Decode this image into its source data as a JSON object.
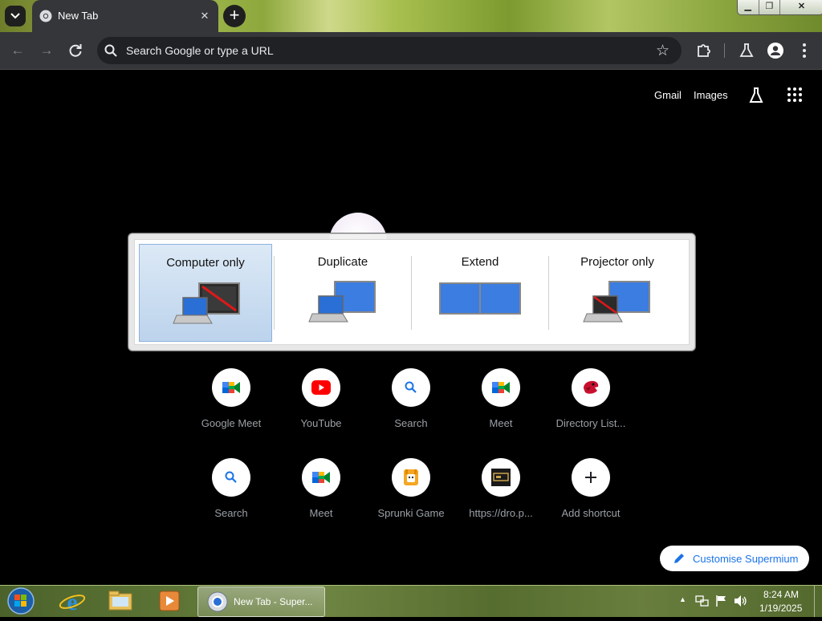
{
  "browser": {
    "tab_title": "New Tab",
    "tab_close": "✕",
    "new_tab": "+",
    "window_controls": {
      "minimize": "▁",
      "maximize": "❐",
      "close": "✕"
    },
    "omnibox_placeholder": "Search Google or type a URL",
    "icons": [
      "tab-search-icon",
      "chrome-favicon",
      "back-icon",
      "forward-icon",
      "reload-icon",
      "search-icon",
      "bookmark-star-icon",
      "extensions-icon",
      "labs-icon",
      "profile-icon",
      "menu-icon"
    ]
  },
  "ntp": {
    "header_links": {
      "gmail": "Gmail",
      "images": "Images"
    },
    "shortcuts": [
      {
        "label": "Google Meet",
        "icon": "google-meet-icon"
      },
      {
        "label": "YouTube",
        "icon": "youtube-icon"
      },
      {
        "label": "Search",
        "icon": "search-icon"
      },
      {
        "label": "Meet",
        "icon": "google-meet-icon"
      },
      {
        "label": "Directory List...",
        "icon": "red-bird-icon"
      },
      {
        "label": "Search",
        "icon": "search-icon"
      },
      {
        "label": "Meet",
        "icon": "google-meet-icon"
      },
      {
        "label": "Sprunki Game",
        "icon": "sprunki-icon"
      },
      {
        "label": "https://dro.p...",
        "icon": "site-thumbnail-icon"
      },
      {
        "label": "Add shortcut",
        "icon": "plus-icon"
      }
    ],
    "customise_label": "Customise Supermium"
  },
  "display_switcher": {
    "options": [
      {
        "label": "Computer only",
        "selected": true
      },
      {
        "label": "Duplicate",
        "selected": false
      },
      {
        "label": "Extend",
        "selected": false
      },
      {
        "label": "Projector only",
        "selected": false
      }
    ]
  },
  "taskbar": {
    "active_task": "New Tab - Super...",
    "time": "8:24 AM",
    "date": "1/19/2025"
  },
  "colors": {
    "ntp_bg": "#000000",
    "toolbar": "#35363a",
    "accent": "#1a73e8",
    "selected_option": "#bcd3ec"
  }
}
